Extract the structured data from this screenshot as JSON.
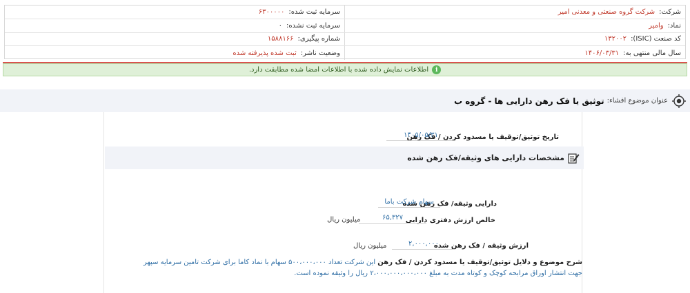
{
  "company_info": {
    "company_label": "شرکت:",
    "company_value": "شرکت گروه صنعتی و معدنی امیر",
    "symbol_label": "نماد:",
    "symbol_value": "وامیر",
    "isic_label": "کد صنعت (ISIC):",
    "isic_value": "۱۳۲۰۰۲",
    "fiscal_label": "سال مالی منتهی به:",
    "fiscal_value": "۱۴۰۶/۰۳/۳۱",
    "registered_capital_label": "سرمایه ثبت شده:",
    "registered_capital_value": "۶۳۰۰۰۰۰",
    "unregistered_capital_label": "سرمایه ثبت نشده:",
    "unregistered_capital_value": "۰",
    "tracking_label": "شماره پیگیری:",
    "tracking_value": "۱۵۸۸۱۶۶",
    "status_label": "وضعیت ناشر:",
    "status_value": "ثبت شده پذیرفته شده"
  },
  "success_message": "اطلاعات نمایش داده شده با اطلاعات امضا شده مطابقت دارد.",
  "success_icon_glyph": "i",
  "subject": {
    "label": "عنوان موضوع افشاء:",
    "title": "توثیق یا فک رهن دارایی ها - گروه ب"
  },
  "date_row": {
    "label": "تاریخ توثیق/توقیف یا مسدود کردن / فک رهن",
    "value": "۱۴۰۵/۰۵/۳۱"
  },
  "section": {
    "title": "مشخصات دارایی های وثیقه/فک رهن شده"
  },
  "asset": {
    "label": "دارایی وثیقه/ فک رهن شده",
    "value": "سهام شرکت باما"
  },
  "book_value": {
    "label": "خالص ارزش دفتری دارایی",
    "value": "۶۵,۳۲۷",
    "unit": "میلیون ریال"
  },
  "pledge_value": {
    "label": "ارزش وثیقه / فک رهن شده",
    "value": "۲,۰۰۰,۰۰۰",
    "unit": "میلیون ریال"
  },
  "description": {
    "label": "شرح موضوع و دلایل توثیق/توقیف یا مسدود کردن / فک رهن",
    "text": "این شرکت تعداد ۵۰۰،۰۰۰،۰۰۰ سهام با نماد کاما برای شرکت تامین سرمایه سپهر جهت انتشار اوراق مرابحه کوچک و کوتاه مدت به مبلغ ۲،۰۰۰،۰۰۰،۰۰۰،۰۰۰ ریال را وثیقه نموده است."
  }
}
